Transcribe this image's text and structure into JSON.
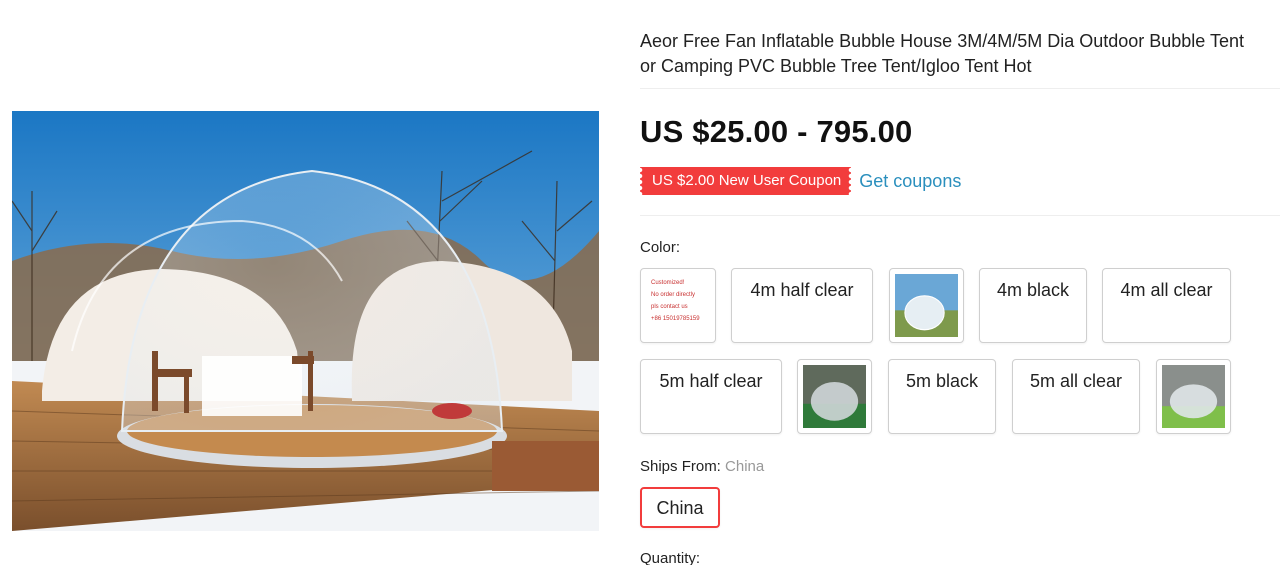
{
  "product": {
    "title_line1": "Aeor Free Fan Inflatable Bubble House 3M/4M/5M Dia Outdoor Bubble Tent",
    "title_line2": "or Camping PVC Bubble Tree Tent/Igloo Tent Hot",
    "price": "US $25.00 - 795.00",
    "image_icon": "product-photo"
  },
  "coupon": {
    "badge": "US $2.00 New User Coupon",
    "link": "Get coupons"
  },
  "color": {
    "label": "Color:",
    "note_card": [
      "Customized!",
      "No order directly",
      "pls contact us",
      "+86 15019785159"
    ],
    "options": [
      {
        "label": "4m half clear"
      },
      {
        "label": "4m black"
      },
      {
        "label": "4m all clear"
      },
      {
        "label": "5m half clear"
      },
      {
        "label": "5m black"
      },
      {
        "label": "5m all clear"
      }
    ]
  },
  "ships": {
    "label": "Ships From:",
    "value": "China",
    "option": "China"
  },
  "quantity": {
    "label": "Quantity:"
  },
  "colors": {
    "accent_red": "#f23c3c",
    "link_blue": "#2a8fbd"
  }
}
